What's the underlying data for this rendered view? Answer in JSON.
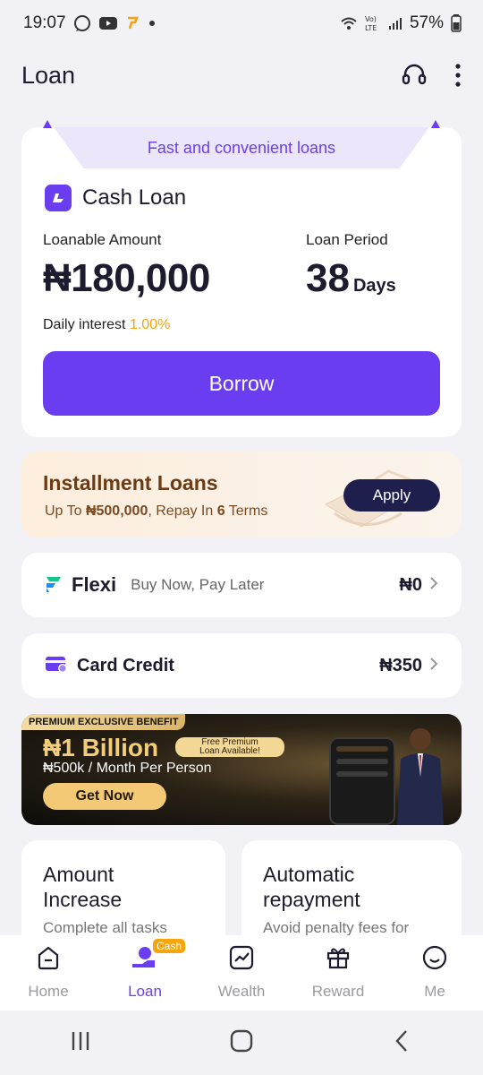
{
  "status_bar": {
    "time": "19:07",
    "battery": "57%",
    "icons": [
      "whatsapp-icon",
      "youtube-icon",
      "palmpay-icon",
      "dot-icon",
      "wifi-calling-icon",
      "volte-icon",
      "signal-icon",
      "battery-icon"
    ]
  },
  "header": {
    "title": "Loan",
    "actions": [
      "headset-icon",
      "more-vertical-icon"
    ]
  },
  "cash_loan": {
    "ribbon": "Fast and convenient loans",
    "title": "Cash Loan",
    "amount_label": "Loanable Amount",
    "amount": "₦180,000",
    "period_label": "Loan Period",
    "period_value": "38",
    "period_unit": "Days",
    "interest_label": "Daily interest",
    "interest_rate": "1.00%",
    "borrow_label": "Borrow"
  },
  "installment": {
    "title": "Installment Loans",
    "sub_prefix": "Up To ",
    "sub_amount": "₦500,000",
    "sub_middle": ", Repay In ",
    "sub_terms": "6",
    "sub_suffix": " Terms",
    "apply_label": "Apply"
  },
  "flexi": {
    "name": "Flexi",
    "subtitle": "Buy Now, Pay Later",
    "value": "₦0"
  },
  "card_credit": {
    "name": "Card Credit",
    "value": "₦350"
  },
  "banner": {
    "tag": "PREMIUM EXCLUSIVE BENEFIT",
    "headline": "₦1 Billion",
    "pill_line1": "Free Premium",
    "pill_line2": "Loan Available!",
    "subtitle": "₦500k / Month Per Person",
    "cta": "Get Now"
  },
  "features": [
    {
      "title_line1": "Amount",
      "title_line2": "Increase",
      "desc": "Complete all tasks"
    },
    {
      "title_line1": "Automatic",
      "title_line2": "repayment",
      "desc": "Avoid penalty fees for"
    }
  ],
  "bottom_nav": {
    "items": [
      {
        "label": "Home",
        "icon": "home-icon"
      },
      {
        "label": "Loan",
        "icon": "loan-icon",
        "badge": "Cash",
        "active": true
      },
      {
        "label": "Wealth",
        "icon": "wealth-icon"
      },
      {
        "label": "Reward",
        "icon": "gift-icon"
      },
      {
        "label": "Me",
        "icon": "smile-icon"
      }
    ]
  },
  "colors": {
    "accent": "#6a3df0",
    "interest": "#f4a30b",
    "installment_bg": "#fdeedd",
    "apply_bg": "#1e1f4d",
    "banner_gold": "#f3c976"
  }
}
